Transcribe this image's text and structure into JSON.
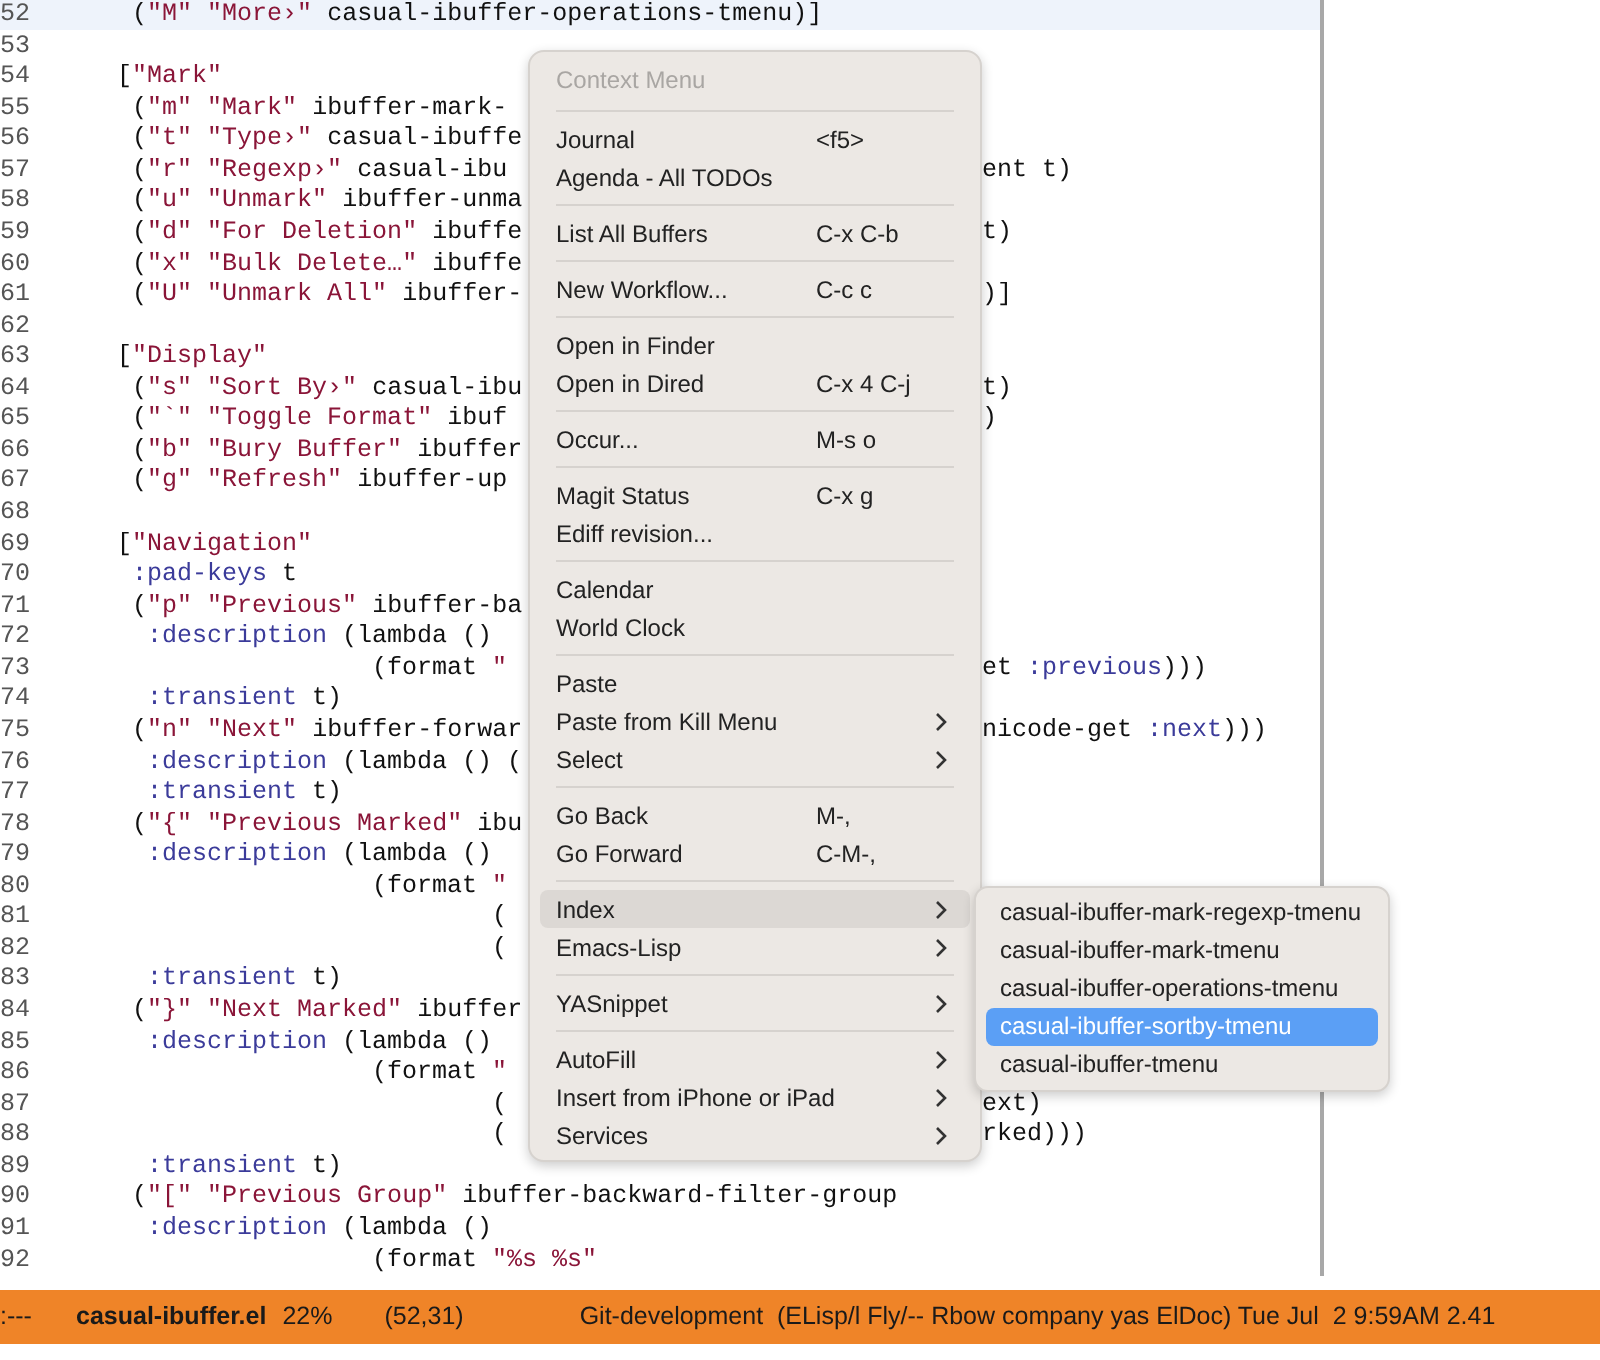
{
  "editor": {
    "lines": [
      {
        "number": "52",
        "text": "    (\"M\" \"More›\" casual-ibuffer-operations-tmenu)]",
        "current": true
      },
      {
        "number": "53",
        "current": false
      },
      {
        "number": "54",
        "text": "   [\"Mark\"",
        "current": false
      },
      {
        "number": "55",
        "text": "    (\"m\" \"Mark\" ibuffer-mark-",
        "current": false
      },
      {
        "number": "56",
        "text": "    (\"t\" \"Type›\" casual-ibuffe",
        "current": false
      },
      {
        "number": "57",
        "text": "    (\"r\" \"Regexp›\" casual-ibu",
        "tail": "ent t)",
        "current": false
      },
      {
        "number": "58",
        "text": "    (\"u\" \"Unmark\" ibuffer-unma",
        "current": false
      },
      {
        "number": "59",
        "text": "    (\"d\" \"For Deletion\" ibuffe",
        "tail": "t)",
        "current": false
      },
      {
        "number": "60",
        "text": "    (\"x\" \"Bulk Delete…\" ibuffe",
        "current": false
      },
      {
        "number": "61",
        "text": "    (\"U\" \"Unmark All\" ibuffer-",
        "tail": ")]",
        "current": false
      },
      {
        "number": "62",
        "current": false
      },
      {
        "number": "63",
        "text": "   [\"Display\"",
        "current": false
      },
      {
        "number": "64",
        "text": "    (\"s\" \"Sort By›\" casual-ibu",
        "tail": "t)",
        "current": false
      },
      {
        "number": "65",
        "text": "    (\"`\" \"Toggle Format\" ibuf",
        "tail": ")",
        "current": false
      },
      {
        "number": "66",
        "text": "    (\"b\" \"Bury Buffer\" ibuffer",
        "current": false
      },
      {
        "number": "67",
        "text": "    (\"g\" \"Refresh\" ibuffer-up",
        "current": false
      },
      {
        "number": "68",
        "current": false
      },
      {
        "number": "69",
        "text": "   [\"Navigation\"",
        "current": false
      },
      {
        "number": "70",
        "text": "    :pad-keys t",
        "current": false
      },
      {
        "number": "71",
        "text": "    (\"p\" \"Previous\" ibuffer-ba",
        "current": false
      },
      {
        "number": "72",
        "text": "     :description (lambda ()",
        "current": false
      },
      {
        "number": "73",
        "text": "                    (format \"",
        "tail": "et :previous)))",
        "current": false
      },
      {
        "number": "74",
        "text": "     :transient t)",
        "current": false
      },
      {
        "number": "75",
        "text": "    (\"n\" \"Next\" ibuffer-forwar",
        "tail": "nicode-get :next)))",
        "current": false
      },
      {
        "number": "76",
        "text": "     :description (lambda () (",
        "current": false
      },
      {
        "number": "77",
        "text": "     :transient t)",
        "current": false
      },
      {
        "number": "78",
        "text": "    (\"{\" \"Previous Marked\" ibu",
        "current": false
      },
      {
        "number": "79",
        "text": "     :description (lambda ()",
        "current": false
      },
      {
        "number": "80",
        "text": "                    (format \"",
        "current": false
      },
      {
        "number": "81",
        "text": "                            (",
        "current": false
      },
      {
        "number": "82",
        "text": "                            (",
        "current": false
      },
      {
        "number": "83",
        "text": "     :transient t)",
        "current": false
      },
      {
        "number": "84",
        "text": "    (\"}\" \"Next Marked\" ibuffer",
        "current": false
      },
      {
        "number": "85",
        "text": "     :description (lambda ()",
        "current": false
      },
      {
        "number": "86",
        "text": "                    (format \"",
        "current": false
      },
      {
        "number": "87",
        "text": "                            (",
        "tail": "ext)",
        "current": false
      },
      {
        "number": "88",
        "text": "                            (",
        "tail": "rked)))",
        "current": false
      },
      {
        "number": "89",
        "text": "     :transient t)",
        "current": false
      },
      {
        "number": "90",
        "text": "    (\"[\" \"Previous Group\" ibuffer-backward-filter-group",
        "current": false
      },
      {
        "number": "91",
        "text": "     :description (lambda ()",
        "current": false
      },
      {
        "number": "92",
        "text": "                    (format \"%s %s\"",
        "current": false
      }
    ]
  },
  "context_menu": {
    "title": "Context Menu",
    "groups": [
      [
        {
          "label": "Journal",
          "shortcut": "<f5>",
          "submenu": false,
          "selected": false
        },
        {
          "label": "Agenda - All TODOs",
          "submenu": false,
          "selected": false
        }
      ],
      [
        {
          "label": "List All Buffers",
          "shortcut": "C-x C-b",
          "submenu": false,
          "selected": false
        }
      ],
      [
        {
          "label": "New Workflow...",
          "shortcut": "C-c c",
          "submenu": false,
          "selected": false
        }
      ],
      [
        {
          "label": "Open in Finder",
          "submenu": false,
          "selected": false
        },
        {
          "label": "Open in Dired",
          "shortcut": "C-x 4 C-j",
          "submenu": false,
          "selected": false
        }
      ],
      [
        {
          "label": "Occur...",
          "shortcut": "M-s o",
          "submenu": false,
          "selected": false
        }
      ],
      [
        {
          "label": "Magit Status",
          "shortcut": "C-x g",
          "submenu": false,
          "selected": false
        },
        {
          "label": "Ediff revision...",
          "submenu": false,
          "selected": false
        }
      ],
      [
        {
          "label": "Calendar",
          "submenu": false,
          "selected": false
        },
        {
          "label": "World Clock",
          "submenu": false,
          "selected": false
        }
      ],
      [
        {
          "label": "Paste",
          "submenu": false,
          "selected": false
        },
        {
          "label": "Paste from Kill Menu",
          "submenu": true,
          "selected": false
        },
        {
          "label": "Select",
          "submenu": true,
          "selected": false
        }
      ],
      [
        {
          "label": "Go Back",
          "shortcut": "M-,",
          "submenu": false,
          "selected": false
        },
        {
          "label": "Go Forward",
          "shortcut": "C-M-,",
          "submenu": false,
          "selected": false
        }
      ],
      [
        {
          "label": "Index",
          "submenu": true,
          "selected": true
        },
        {
          "label": "Emacs-Lisp",
          "submenu": true,
          "selected": false
        }
      ],
      [
        {
          "label": "YASnippet",
          "submenu": true,
          "selected": false
        }
      ],
      [
        {
          "label": "AutoFill",
          "submenu": true,
          "selected": false
        },
        {
          "label": "Insert from iPhone or iPad",
          "submenu": true,
          "selected": false
        },
        {
          "label": "Services",
          "submenu": true,
          "selected": false
        }
      ]
    ]
  },
  "submenu": {
    "items": [
      {
        "label": "casual-ibuffer-mark-regexp-tmenu",
        "selected": false
      },
      {
        "label": "casual-ibuffer-mark-tmenu",
        "selected": false
      },
      {
        "label": "casual-ibuffer-operations-tmenu",
        "selected": false
      },
      {
        "label": "casual-ibuffer-sortby-tmenu",
        "selected": true
      },
      {
        "label": "casual-ibuffer-tmenu",
        "selected": false
      }
    ]
  },
  "status_bar": {
    "state": ":---",
    "buffer": "casual-ibuffer.el",
    "position_percent": "22%",
    "cursor": "(52,31)",
    "info": "Git-development  (ELisp/l Fly/-- Rbow company yas ElDoc) Tue Jul  2 9:59AM 2.41"
  }
}
